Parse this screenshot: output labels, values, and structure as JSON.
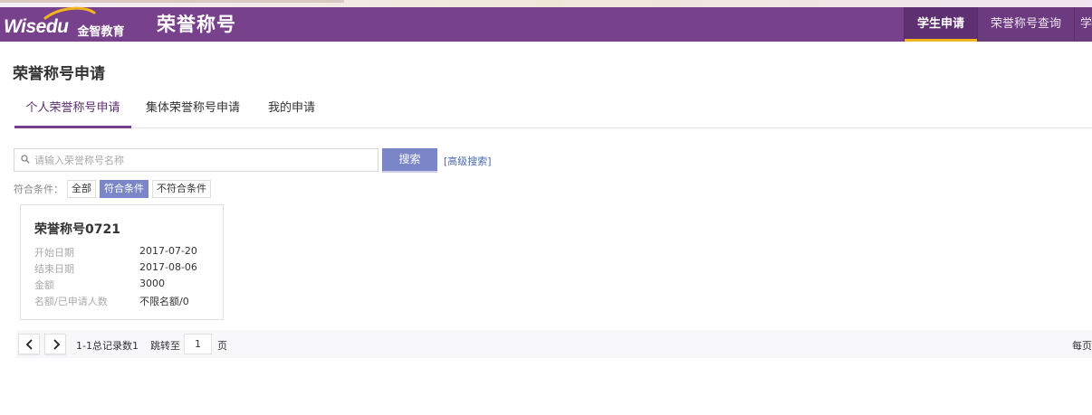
{
  "brand": {
    "logo_text": "Wisedu",
    "logo_cn": "金智教育",
    "app_title": "荣誉称号",
    "accent_color": "#77418b",
    "highlight_color": "#f3b51d",
    "button_color": "#7a86c8"
  },
  "nav": {
    "items": [
      {
        "label": "学生申请",
        "active": true
      },
      {
        "label": "荣誉称号查询",
        "active": false
      },
      {
        "label": "学",
        "active": false
      }
    ]
  },
  "page": {
    "title": "荣誉称号申请"
  },
  "tabs": [
    {
      "label": "个人荣誉称号申请",
      "active": true
    },
    {
      "label": "集体荣誉称号申请",
      "active": false
    },
    {
      "label": "我的申请",
      "active": false
    }
  ],
  "search": {
    "placeholder": "请输入荣誉称号名称",
    "value": "",
    "button_label": "搜索",
    "advanced_label": "[高级搜索]",
    "icon": "search-icon"
  },
  "filter": {
    "label": "符合条件：",
    "options": [
      {
        "label": "全部",
        "active": false
      },
      {
        "label": "符合条件",
        "active": true
      },
      {
        "label": "不符合条件",
        "active": false
      }
    ]
  },
  "cards": [
    {
      "title": "荣誉称号0721",
      "rows": [
        {
          "key": "开始日期",
          "value": "2017-07-20"
        },
        {
          "key": "结束日期",
          "value": "2017-08-06"
        },
        {
          "key": "金额",
          "value": "3000"
        },
        {
          "key": "名额/已申请人数",
          "value": "不限名额/0"
        }
      ]
    }
  ],
  "pager": {
    "range_text": "1-1总记录数1",
    "jump_label": "跳转至",
    "page_value": "1",
    "page_unit": "页",
    "per_page_label": "每页"
  }
}
